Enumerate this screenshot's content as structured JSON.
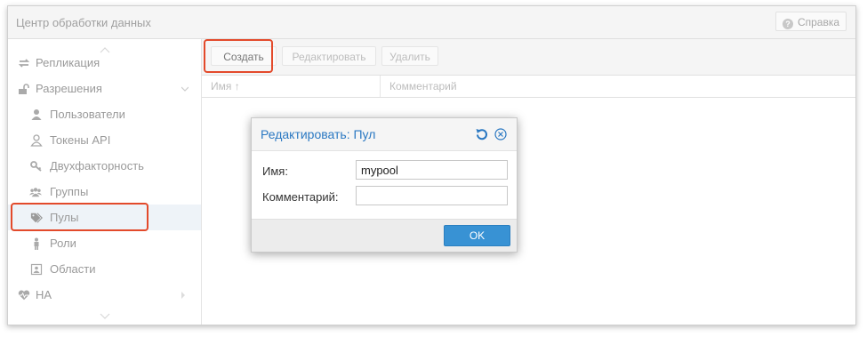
{
  "window": {
    "title": "Центр обработки данных",
    "help_label": "Справка"
  },
  "sidebar": {
    "items": [
      {
        "label": "Репликация",
        "icon": "replication-icon"
      },
      {
        "label": "Разрешения",
        "icon": "unlock-icon"
      },
      {
        "label": "Пользователи",
        "icon": "user-icon"
      },
      {
        "label": "Токены API",
        "icon": "token-icon"
      },
      {
        "label": "Двухфакторность",
        "icon": "key-icon"
      },
      {
        "label": "Группы",
        "icon": "group-icon"
      },
      {
        "label": "Пулы",
        "icon": "tags-icon"
      },
      {
        "label": "Роли",
        "icon": "role-icon"
      },
      {
        "label": "Области",
        "icon": "realm-icon"
      },
      {
        "label": "HA",
        "icon": "heartbeat-icon"
      }
    ]
  },
  "toolbar": {
    "create_label": "Создать",
    "edit_label": "Редактировать",
    "delete_label": "Удалить"
  },
  "grid": {
    "columns": [
      "Имя",
      "Комментарий"
    ],
    "sort_indicator": "↑"
  },
  "dialog": {
    "title": "Редактировать: Пул",
    "name_label": "Имя:",
    "name_value": "mypool",
    "comment_label": "Комментарий:",
    "comment_value": "",
    "ok_label": "OK"
  },
  "colors": {
    "accent": "#3892d4",
    "dialog_title": "#2a78c2",
    "highlight": "#e34a2b"
  }
}
